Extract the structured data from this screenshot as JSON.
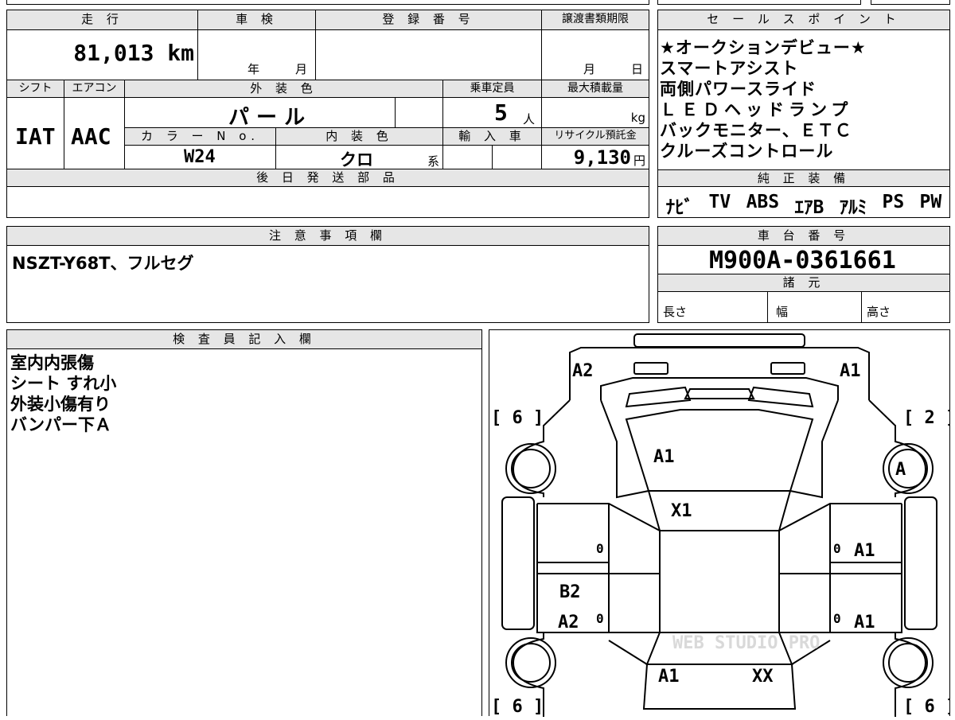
{
  "top": {
    "mileage_label": "走 行",
    "mileage_value": "81,013 km",
    "shaken_label": "車 検",
    "shaken_year": "年",
    "shaken_month": "月",
    "reg_label": "登 録 番 号",
    "transfer_label": "譲渡書類期限",
    "transfer_month": "月",
    "transfer_day": "日"
  },
  "row2": {
    "shift_label": "シフト",
    "aircon_label": "エアコン",
    "shift_value": "IAT",
    "aircon_value": "AAC",
    "exterior_label": "外 装 色",
    "exterior_value": "パ ー ル",
    "capacity_label": "乗車定員",
    "capacity_value": "5",
    "capacity_unit": "人",
    "maxload_label": "最大積載量",
    "maxload_unit": "kg",
    "colorno_label": "カ ラ ー N o.",
    "colorno_value": "W24",
    "interior_label": "内 装 色",
    "interior_value": "クロ",
    "interior_suffix": "系",
    "import_label": "輸 入 車",
    "recycle_label": "リサイクル預託金",
    "recycle_value": "9,130",
    "recycle_unit": "円"
  },
  "later_parts_label": "後 日 発 送 部 品",
  "sales": {
    "label": "セ ー ル ス ポ イ ン ト",
    "lines": [
      "★オークションデビュー★",
      "スマートアシスト",
      "両側パワースライド",
      "ＬＥＤヘッドランプ",
      "バックモニター、ＥＴＣ",
      "クルーズコントロール"
    ]
  },
  "equipment": {
    "label": "純 正 装 備",
    "items": [
      "ﾅﾋﾞ",
      "TV",
      "ABS",
      "ｴｱB",
      "ｱﾙﾐ",
      "PS",
      "PW"
    ]
  },
  "notes": {
    "label": "注 意 事 項 欄",
    "text": "NSZT-Y68T、フルセグ"
  },
  "chassis": {
    "label": "車 台 番 号",
    "value": "M900A-0361661",
    "spec_label": "諸 元",
    "length_label": "長さ",
    "width_label": "幅",
    "height_label": "高さ"
  },
  "inspector": {
    "label": "検 査 員 記 入 欄",
    "lines": [
      "室内内張傷",
      "シート すれ小",
      "外装小傷有り",
      "バンパー下Ａ"
    ]
  },
  "diagram": {
    "marks": {
      "front_left_corner": "A2",
      "front_right_corner": "A1",
      "hood": "A1",
      "roof": "X1",
      "rear_left_door_upper": "B2",
      "rear_left_door": "A2",
      "front_right_door": "A1",
      "rear_right_door": "A1",
      "rear_left": "A1",
      "rear_right": "XX",
      "right_front_wheel": "A"
    },
    "tyres": {
      "front_left": "[ 6 ]",
      "front_right": "[ 2 ]",
      "rear_left": "[ 6 ]",
      "rear_right": "[ 6 ]"
    },
    "zero": "0",
    "watermark": "WEB STUDIO PRO"
  }
}
